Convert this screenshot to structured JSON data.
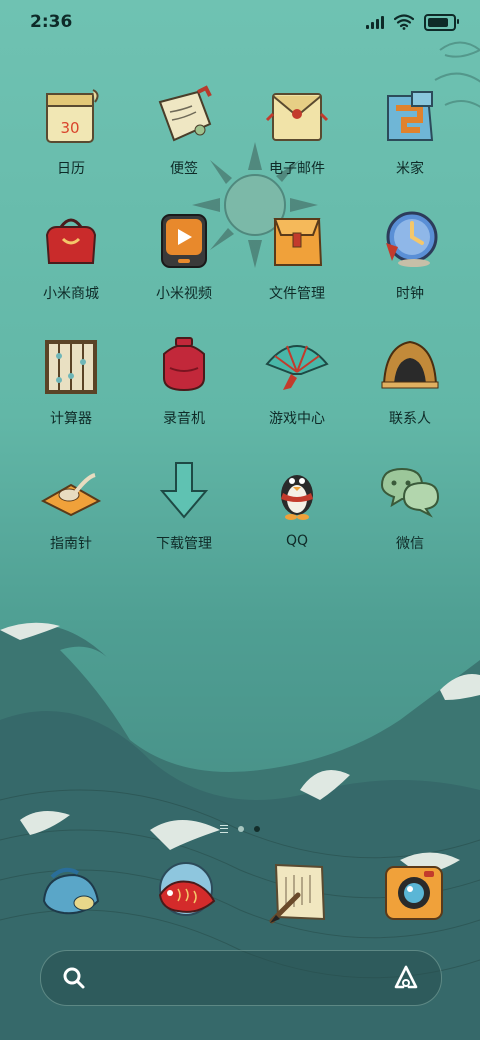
{
  "status_bar": {
    "time": "2:36",
    "battery_percent": 90
  },
  "apps": [
    {
      "label": "日历",
      "icon": "calendar-icon",
      "badge_text": "30"
    },
    {
      "label": "便签",
      "icon": "notes-icon"
    },
    {
      "label": "电子邮件",
      "icon": "email-icon"
    },
    {
      "label": "米家",
      "icon": "mi-home-icon"
    },
    {
      "label": "小米商城",
      "icon": "mi-store-icon"
    },
    {
      "label": "小米视频",
      "icon": "mi-video-icon"
    },
    {
      "label": "文件管理",
      "icon": "file-manager-icon"
    },
    {
      "label": "时钟",
      "icon": "clock-icon"
    },
    {
      "label": "计算器",
      "icon": "calculator-icon"
    },
    {
      "label": "录音机",
      "icon": "recorder-icon"
    },
    {
      "label": "游戏中心",
      "icon": "game-center-icon"
    },
    {
      "label": "联系人",
      "icon": "contacts-icon"
    },
    {
      "label": "指南针",
      "icon": "compass-icon"
    },
    {
      "label": "下载管理",
      "icon": "download-manager-icon"
    },
    {
      "label": "QQ",
      "icon": "qq-icon"
    },
    {
      "label": "微信",
      "icon": "wechat-icon"
    }
  ],
  "page_indicator": {
    "pages": 2,
    "active_page": 2
  },
  "dock": [
    {
      "name": "phone",
      "icon": "phone-icon"
    },
    {
      "name": "messages",
      "icon": "koi-fish-icon"
    },
    {
      "name": "browser",
      "icon": "scroll-brush-icon"
    },
    {
      "name": "camera",
      "icon": "camera-icon"
    }
  ],
  "search": {
    "text": "",
    "search_icon": "search-icon",
    "assistant_icon": "assistant-icon"
  },
  "colors": {
    "background_top": "#6fc2b2",
    "background_bottom": "#3f7f7a",
    "label_color": "#0f2b28"
  }
}
